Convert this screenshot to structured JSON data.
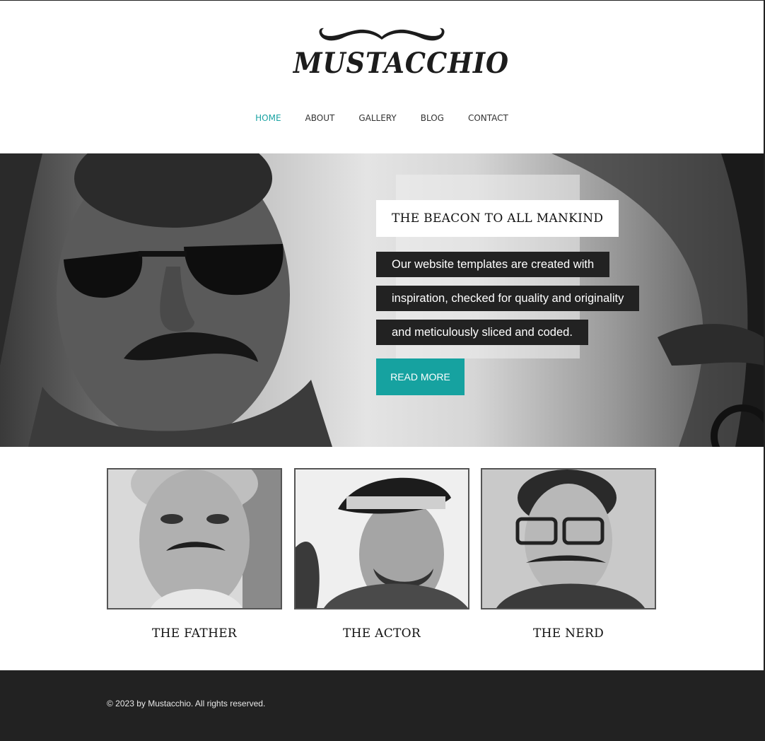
{
  "brand": {
    "logo_text": "MUSTACCHIO"
  },
  "nav": {
    "items": [
      {
        "label": "HOME",
        "active": true
      },
      {
        "label": "ABOUT",
        "active": false
      },
      {
        "label": "GALLERY",
        "active": false
      },
      {
        "label": "BLOG",
        "active": false
      },
      {
        "label": "CONTACT",
        "active": false
      }
    ]
  },
  "hero": {
    "title": "THE BEACON TO ALL MANKIND",
    "lines": [
      "Our website templates are created with",
      "inspiration, checked for quality and originality",
      "and meticulously sliced and coded."
    ],
    "button_label": "READ MORE"
  },
  "cards": [
    {
      "title": "THE FATHER"
    },
    {
      "title": "THE ACTOR"
    },
    {
      "title": "THE NERD"
    }
  ],
  "footer": {
    "copyright": "© 2023 by Mustacchio. All rights reserved."
  },
  "colors": {
    "accent": "#16a2a0",
    "dark": "#222222",
    "text": "#111111"
  }
}
